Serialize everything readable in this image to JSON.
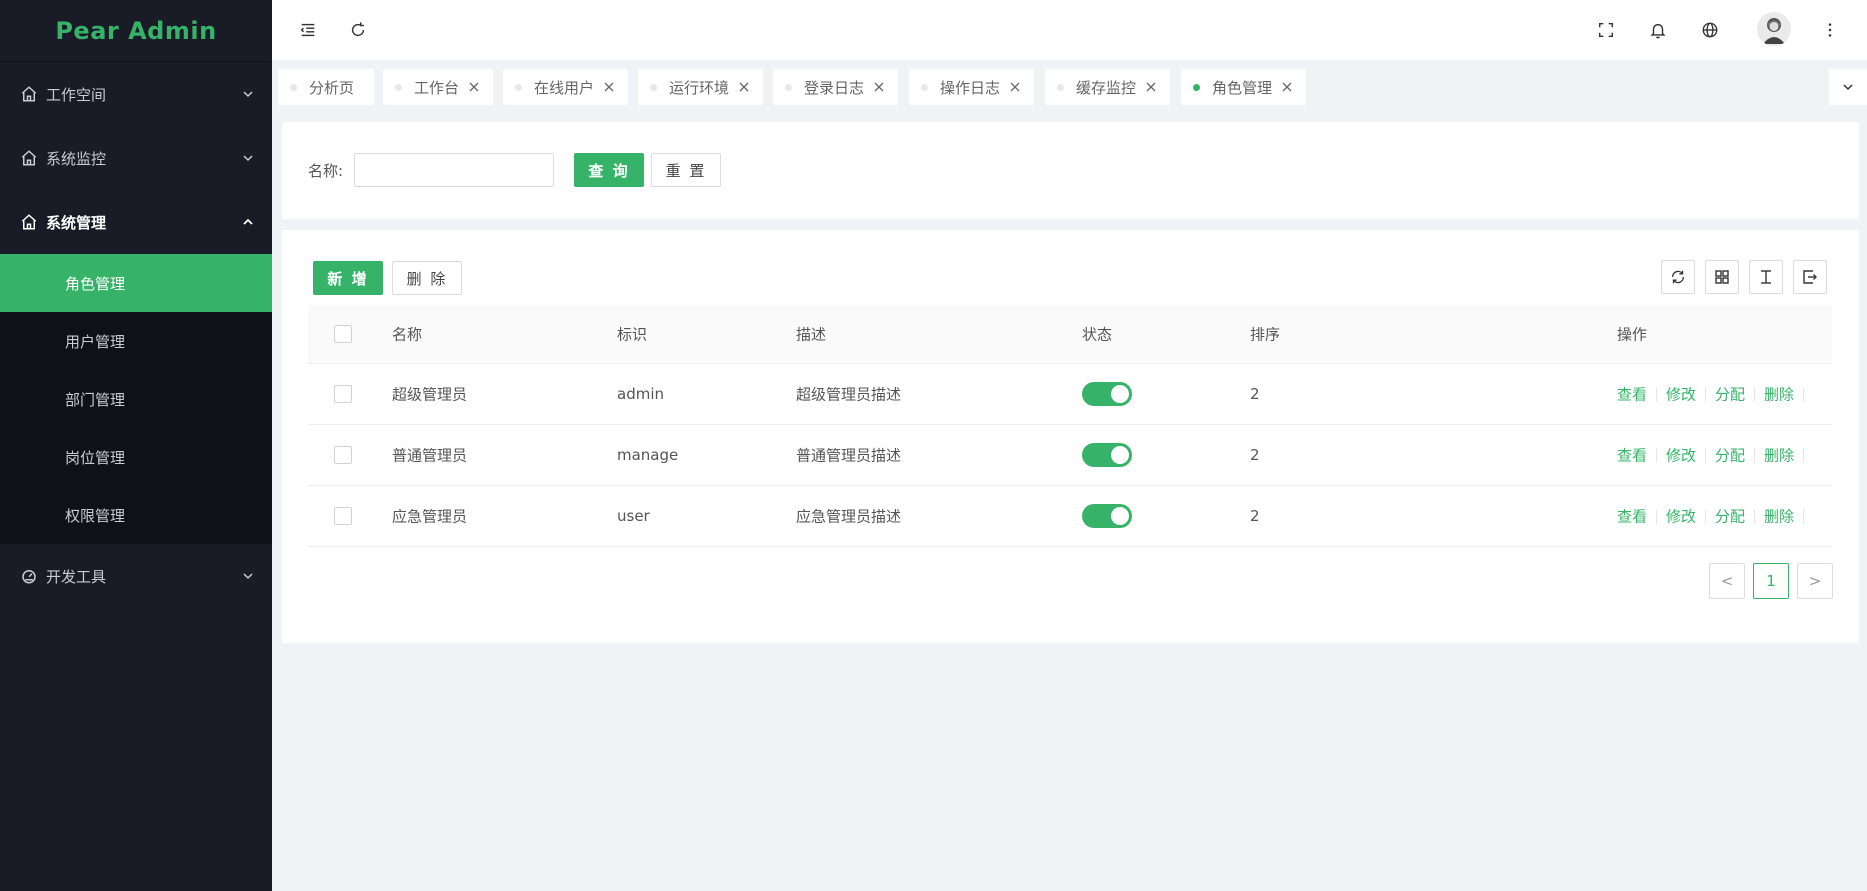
{
  "app": {
    "logo": "Pear Admin"
  },
  "sidebar": {
    "groups": [
      {
        "label": "工作空间",
        "icon": "home-icon"
      },
      {
        "label": "系统监控",
        "icon": "home-icon"
      },
      {
        "label": "系统管理",
        "icon": "home-icon",
        "open": true
      },
      {
        "label": "开发工具",
        "icon": "dashboard-icon"
      }
    ],
    "system_items": [
      {
        "label": "角色管理",
        "active": true
      },
      {
        "label": "用户管理"
      },
      {
        "label": "部门管理"
      },
      {
        "label": "岗位管理"
      },
      {
        "label": "权限管理"
      }
    ]
  },
  "tabs": [
    {
      "label": "分析页",
      "closable": false
    },
    {
      "label": "工作台",
      "closable": true
    },
    {
      "label": "在线用户",
      "closable": true
    },
    {
      "label": "运行环境",
      "closable": true
    },
    {
      "label": "登录日志",
      "closable": true
    },
    {
      "label": "操作日志",
      "closable": true
    },
    {
      "label": "缓存监控",
      "closable": true
    },
    {
      "label": "角色管理",
      "closable": true,
      "active": true
    }
  ],
  "search": {
    "label": "名称:",
    "value": "",
    "placeholder": "",
    "query_label": "查 询",
    "reset_label": "重 置"
  },
  "toolbar": {
    "add_label": "新 增",
    "delete_label": "删 除"
  },
  "table": {
    "headers": {
      "name": "名称",
      "code": "标识",
      "desc": "描述",
      "status": "状态",
      "sort": "排序",
      "ops": "操作"
    },
    "rows": [
      {
        "name": "超级管理员",
        "code": "admin",
        "desc": "超级管理员描述",
        "status": true,
        "sort": "2"
      },
      {
        "name": "普通管理员",
        "code": "manage",
        "desc": "普通管理员描述",
        "status": true,
        "sort": "2"
      },
      {
        "name": "应急管理员",
        "code": "user",
        "desc": "应急管理员描述",
        "status": true,
        "sort": "2"
      }
    ],
    "ops": {
      "view": "查看",
      "edit": "修改",
      "assign": "分配",
      "delete": "删除"
    }
  },
  "pagination": {
    "current": "1",
    "prev": "<",
    "next": ">"
  },
  "colors": {
    "accent": "#36b368",
    "sidebar_bg": "#191b26",
    "submenu_bg": "#0f1117"
  }
}
